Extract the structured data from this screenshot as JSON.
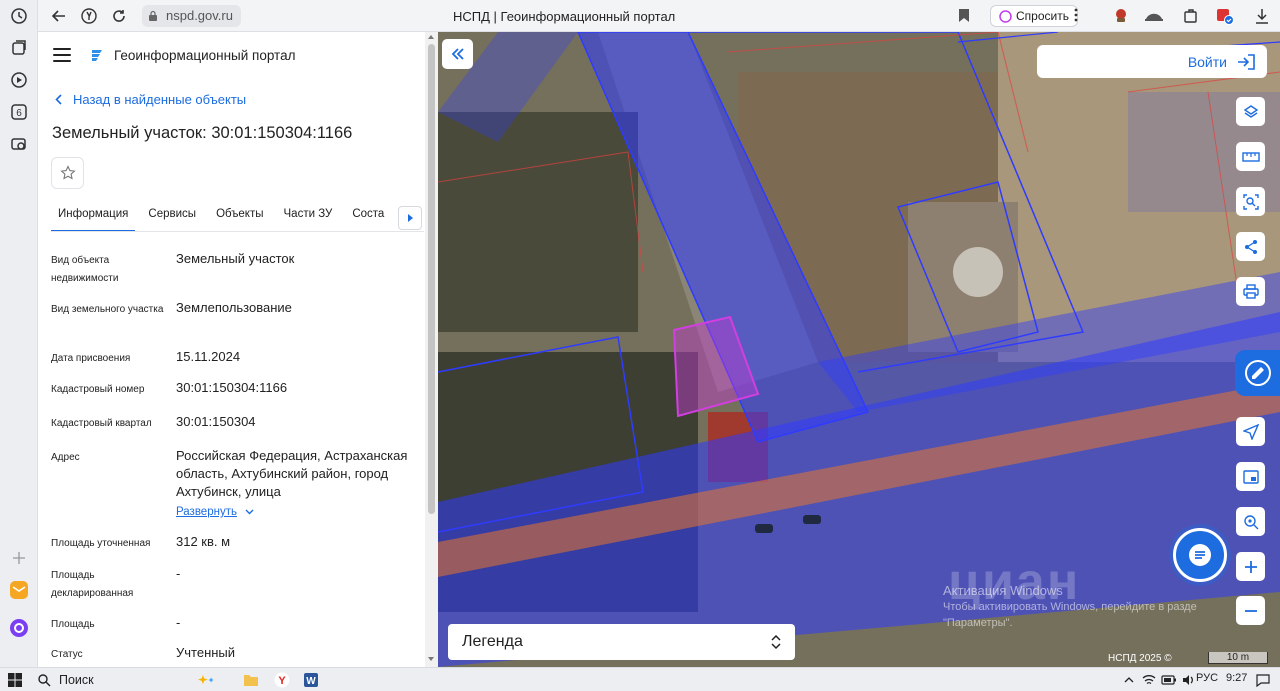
{
  "browser": {
    "url": "nspd.gov.ru",
    "tab_title": "НСПД | Геоинформационный портал",
    "ask_label": "Спросить",
    "sidebar_badge": "6"
  },
  "panel": {
    "portal_title": "Геоинформационный портал",
    "back_label": "Назад в найденные объекты",
    "object_title": "Земельный участок: 30:01:150304:1166",
    "tabs": [
      {
        "label": "Информация"
      },
      {
        "label": "Сервисы"
      },
      {
        "label": "Объекты"
      },
      {
        "label": "Части ЗУ"
      },
      {
        "label": "Соста"
      }
    ],
    "properties": [
      {
        "label": "Вид объекта недвижимости",
        "value": "Земельный участок"
      },
      {
        "label": "Вид земельного участка",
        "value": "Землепользование"
      },
      {
        "label": "Дата присвоения",
        "value": "15.11.2024"
      },
      {
        "label": "Кадастровый номер",
        "value": "30:01:150304:1166"
      },
      {
        "label": "Кадастровый квартал",
        "value": "30:01:150304"
      },
      {
        "label": "Адрес",
        "value": "Российская Федерация, Астраханская область, Ахтубинский район, город Ахтубинск, улица"
      },
      {
        "label": "Площадь уточненная",
        "value": "312 кв. м"
      },
      {
        "label": "Площадь декларированная",
        "value": "-"
      },
      {
        "label": "Площадь",
        "value": "-"
      },
      {
        "label": "Статус",
        "value": "Учтенный"
      }
    ],
    "expand_label": "Развернуть"
  },
  "map": {
    "login_label": "Войти",
    "legend_label": "Легенда",
    "watermark_title": "Активация Windows",
    "watermark_line1": "Чтобы активировать Windows, перейдите в разде",
    "watermark_line2": "\"Параметры\".",
    "cian_text": "циан",
    "copyright": "НСПД 2025 ©",
    "scale_label": "10 m"
  },
  "taskbar": {
    "search_label": "Поиск",
    "language": "РУС",
    "time": "9:27"
  },
  "colors": {
    "accent": "#1d6ce0",
    "zone_blue": "#2f3bff",
    "zone_orange": "#e8742a",
    "parcel_magenta": "#c03bd0"
  }
}
